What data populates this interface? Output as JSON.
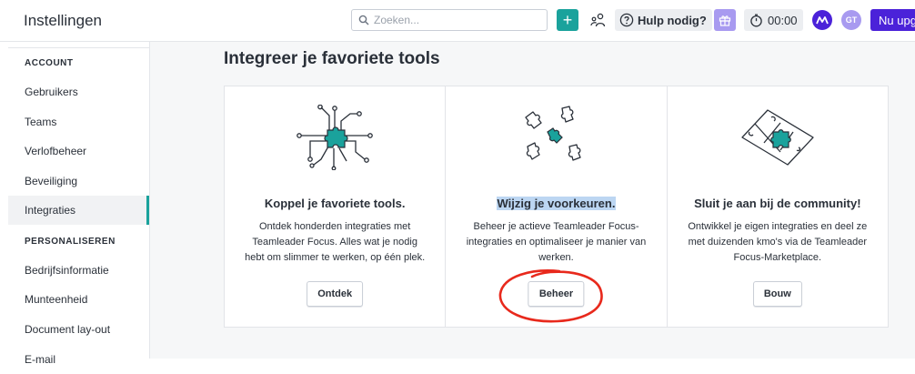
{
  "header": {
    "app_title": "Instellingen",
    "search_placeholder": "Zoeken...",
    "add_label": "+",
    "help_label": "Hulp nodig?",
    "timer": "00:00",
    "avatar_initials": "GT",
    "upgrade_label": "Nu upg"
  },
  "sidebar": {
    "section_account": "ACCOUNT",
    "account_items": [
      {
        "label": "Gebruikers"
      },
      {
        "label": "Teams"
      },
      {
        "label": "Verlofbeheer"
      },
      {
        "label": "Beveiliging"
      },
      {
        "label": "Integraties",
        "active": true
      }
    ],
    "section_personaliseren": "PERSONALISEREN",
    "personaliseren_items": [
      {
        "label": "Bedrijfsinformatie"
      },
      {
        "label": "Munteenheid"
      },
      {
        "label": "Document lay-out"
      },
      {
        "label": "E-mail"
      }
    ]
  },
  "main": {
    "title": "Integreer je favoriete tools",
    "cards": [
      {
        "icon": "circuit-puzzle-icon",
        "title": "Koppel je favoriete tools.",
        "desc_lines": [
          "Ontdek honderden integraties met",
          "Teamleader Focus. Alles wat je nodig",
          "hebt om slimmer te werken, op één plek."
        ],
        "button": "Ontdek"
      },
      {
        "icon": "scattered-puzzle-icon",
        "title": "Wijzig je voorkeuren.",
        "desc_lines": [
          "Beheer je actieve Teamleader Focus-",
          "integraties en optimaliseer je manier van",
          "werken."
        ],
        "button": "Beheer"
      },
      {
        "icon": "puzzle-diamond-icon",
        "title": "Sluit je aan bij de community!",
        "desc_lines": [
          "Ontwikkel je eigen integraties en deel ze",
          "met duizenden kmo's via de Teamleader",
          "Focus-Marketplace."
        ],
        "button": "Bouw"
      }
    ]
  },
  "colors": {
    "teal": "#1aa29c",
    "purple": "#4b22d9",
    "lavender": "#a89af0",
    "highlight": "#bcd6f2",
    "annotation_red": "#e8291c"
  }
}
